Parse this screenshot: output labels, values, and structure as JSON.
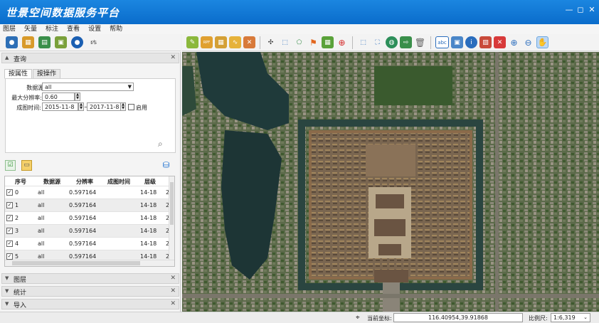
{
  "app": {
    "title": "世景空间数据服务平台",
    "window_buttons": [
      "—",
      "◻",
      "✕"
    ]
  },
  "menu": [
    "图层",
    "矢量",
    "标注",
    "查看",
    "设置",
    "帮助"
  ],
  "left_toolbar": {
    "icons": [
      "satellite-icon",
      "grid-view-icon",
      "layers-icon",
      "lock-icon",
      "user-icon",
      "tag-icon"
    ],
    "extra_label": "r⁄s"
  },
  "right_toolbar": {
    "icons": [
      "map-edit-icon",
      "export-rpf-icon",
      "grid-select-icon",
      "draw-polyline-icon",
      "delete-polyline-icon",
      "cursor-select-icon",
      "rect-select-icon",
      "polygon-select-icon",
      "flag-icon",
      "grid-icon",
      "target-icon",
      "vertex-select-icon",
      "zoom-extent-icon",
      "globe-icon",
      "export-icon",
      "trash-icon",
      "text-label-icon",
      "image-icon",
      "info-icon",
      "photo-icon",
      "remove-layer-icon",
      "zoom-in-icon",
      "zoom-out-icon",
      "pan-hand-icon"
    ],
    "text_label": "abc"
  },
  "query_panel": {
    "header": "查询",
    "tabs": [
      "按属性",
      "按操作"
    ],
    "datasource_label": "数据源:",
    "datasource_value": "all",
    "max_res_label": "最大分辨率:",
    "max_res_value": "0.60",
    "date_label": "成图时间:",
    "date_start": "2015-11-8",
    "date_sep": "~",
    "date_end": "2017-11-8",
    "enable_label": "启用"
  },
  "results_table": {
    "columns": [
      "序号",
      "数据源",
      "分辨率",
      "成图时间",
      "层级",
      "2"
    ],
    "rows": [
      {
        "idx": "0",
        "source": "all",
        "res": "0.597164",
        "time": "",
        "level": "14-18",
        "extra": "2"
      },
      {
        "idx": "1",
        "source": "all",
        "res": "0.597164",
        "time": "",
        "level": "14-18",
        "extra": "2"
      },
      {
        "idx": "2",
        "source": "all",
        "res": "0.597164",
        "time": "",
        "level": "14-18",
        "extra": "2"
      },
      {
        "idx": "3",
        "source": "all",
        "res": "0.597164",
        "time": "",
        "level": "14-18",
        "extra": "2"
      },
      {
        "idx": "4",
        "source": "all",
        "res": "0.597164",
        "time": "",
        "level": "14-18",
        "extra": "2"
      },
      {
        "idx": "5",
        "source": "all",
        "res": "0.597164",
        "time": "",
        "level": "14-18",
        "extra": "2"
      }
    ]
  },
  "collapsed_sections": [
    "图层",
    "统计",
    "导入"
  ],
  "status": {
    "coord_label": "当前坐标:",
    "coord_value": "116.40954,39.91868",
    "scale_label": "比例尺:",
    "scale_value": "1:6,319"
  }
}
